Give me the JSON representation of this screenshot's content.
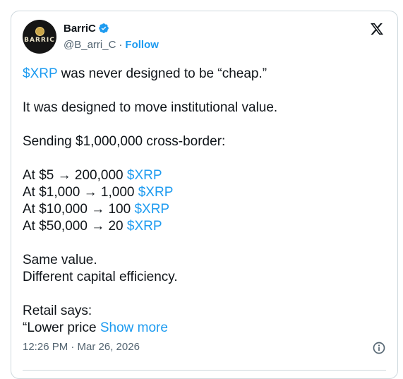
{
  "author": {
    "display_name": "BarriC",
    "handle": "@B_arri_C",
    "separator": "·",
    "follow_label": "Follow",
    "avatar_text": "BARRIC"
  },
  "tweet": {
    "line1_link": "$XRP",
    "line1_rest": " was never designed to be “cheap.”",
    "line2": "It was designed to move institutional value.",
    "line3": "Sending $1,000,000 cross-border:",
    "rows": [
      {
        "text": "At $5 → 200,000 ",
        "link": "$XRP"
      },
      {
        "text": "At $1,000 → 1,000 ",
        "link": "$XRP"
      },
      {
        "text": "At $10,000 → 100 ",
        "link": "$XRP"
      },
      {
        "text": "At $50,000 → 20 ",
        "link": "$XRP"
      }
    ],
    "line4": "Same value.",
    "line5": "Different capital efficiency.",
    "line6": "Retail says:",
    "line7_text": "“Lower price ",
    "show_more": "Show more"
  },
  "footer": {
    "timestamp": "12:26 PM · Mar 26, 2026"
  },
  "colors": {
    "link": "#1d9bf0",
    "text": "#0f1419",
    "muted": "#536471"
  },
  "icons": [
    "verified-badge-icon",
    "x-logo-icon",
    "info-icon"
  ]
}
